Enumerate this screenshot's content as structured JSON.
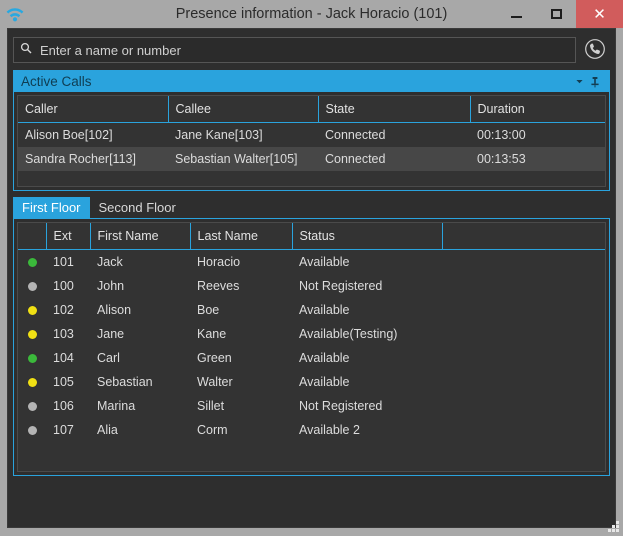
{
  "window": {
    "title": "Presence information - Jack Horacio (101)",
    "app_icon": "wifi-signal-icon",
    "controls": {
      "minimize_label": "–",
      "maximize_label": "□",
      "close_label": "✕"
    },
    "close_color": "#d15c5c",
    "titlebar_color": "#a8a8a8"
  },
  "search": {
    "placeholder": "Enter a name or number",
    "value": "",
    "icon": "search-icon",
    "call_button_icon": "phone-call-icon"
  },
  "active_calls": {
    "title": "Active Calls",
    "accent_color": "#2aa3dd",
    "collapse_icon": "chevron-down-icon",
    "pin_icon": "pin-icon",
    "columns": [
      "Caller",
      "Callee",
      "State",
      "Duration"
    ],
    "rows": [
      {
        "caller": "Alison Boe[102]",
        "callee": "Jane Kane[103]",
        "state": "Connected",
        "duration": "00:13:00"
      },
      {
        "caller": "Sandra Rocher[113]",
        "callee": "Sebastian Walter[105]",
        "state": "Connected",
        "duration": "00:13:53"
      }
    ]
  },
  "tabs": [
    {
      "label": "First Floor",
      "active": true
    },
    {
      "label": "Second Floor",
      "active": false
    }
  ],
  "contacts": {
    "columns": [
      "",
      "Ext",
      "First Name",
      "Last Name",
      "Status",
      ""
    ],
    "status_colors": {
      "available": "#3bb93b",
      "busy": "#f0e014",
      "offline": "#b4b4b4"
    },
    "rows": [
      {
        "dot": "#3bb93b",
        "ext": "101",
        "first_name": "Jack",
        "last_name": "Horacio",
        "status": "Available"
      },
      {
        "dot": "#b4b4b4",
        "ext": "100",
        "first_name": "John",
        "last_name": "Reeves",
        "status": "Not Registered"
      },
      {
        "dot": "#f0e014",
        "ext": "102",
        "first_name": "Alison",
        "last_name": "Boe",
        "status": "Available"
      },
      {
        "dot": "#f0e014",
        "ext": "103",
        "first_name": "Jane",
        "last_name": "Kane",
        "status": "Available(Testing)"
      },
      {
        "dot": "#3bb93b",
        "ext": "104",
        "first_name": "Carl",
        "last_name": "Green",
        "status": "Available"
      },
      {
        "dot": "#f0e014",
        "ext": "105",
        "first_name": "Sebastian",
        "last_name": "Walter",
        "status": "Available"
      },
      {
        "dot": "#b4b4b4",
        "ext": "106",
        "first_name": "Marina",
        "last_name": "Sillet",
        "status": "Not Registered"
      },
      {
        "dot": "#b4b4b4",
        "ext": "107",
        "first_name": "Alia",
        "last_name": "Corm",
        "status": "Available 2"
      }
    ]
  },
  "resize_grip": "resize-grip"
}
